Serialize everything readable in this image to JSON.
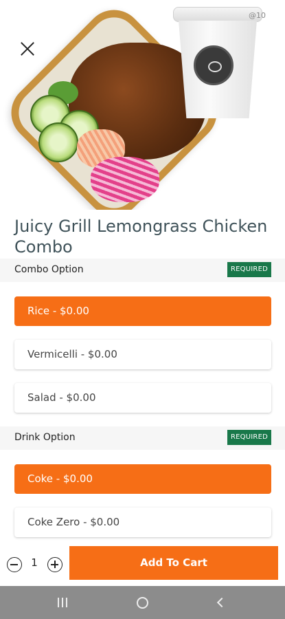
{
  "item": {
    "title": "Juicy Grill Lemongrass Chicken Combo",
    "cup_tag": "@10"
  },
  "sections": [
    {
      "label": "Combo Option",
      "badge": "REQUIRED",
      "options": [
        "Rice - $0.00",
        "Vermicelli - $0.00",
        "Salad - $0.00"
      ],
      "selected": "Rice - $0.00"
    },
    {
      "label": "Drink Option",
      "badge": "REQUIRED",
      "options": [
        "Coke - $0.00",
        "Coke Zero - $0.00"
      ],
      "selected": "Coke - $0.00"
    }
  ],
  "cart": {
    "quantity": "1",
    "add_label": "Add To Cart"
  },
  "colors": {
    "accent": "#f66e16",
    "badge": "#19784a",
    "title": "#3f5259"
  },
  "icons": {
    "close": "close-icon",
    "minus": "minus-circle-icon",
    "plus": "plus-circle-icon",
    "recent": "recent-apps-icon",
    "home": "home-icon",
    "back": "back-icon"
  }
}
